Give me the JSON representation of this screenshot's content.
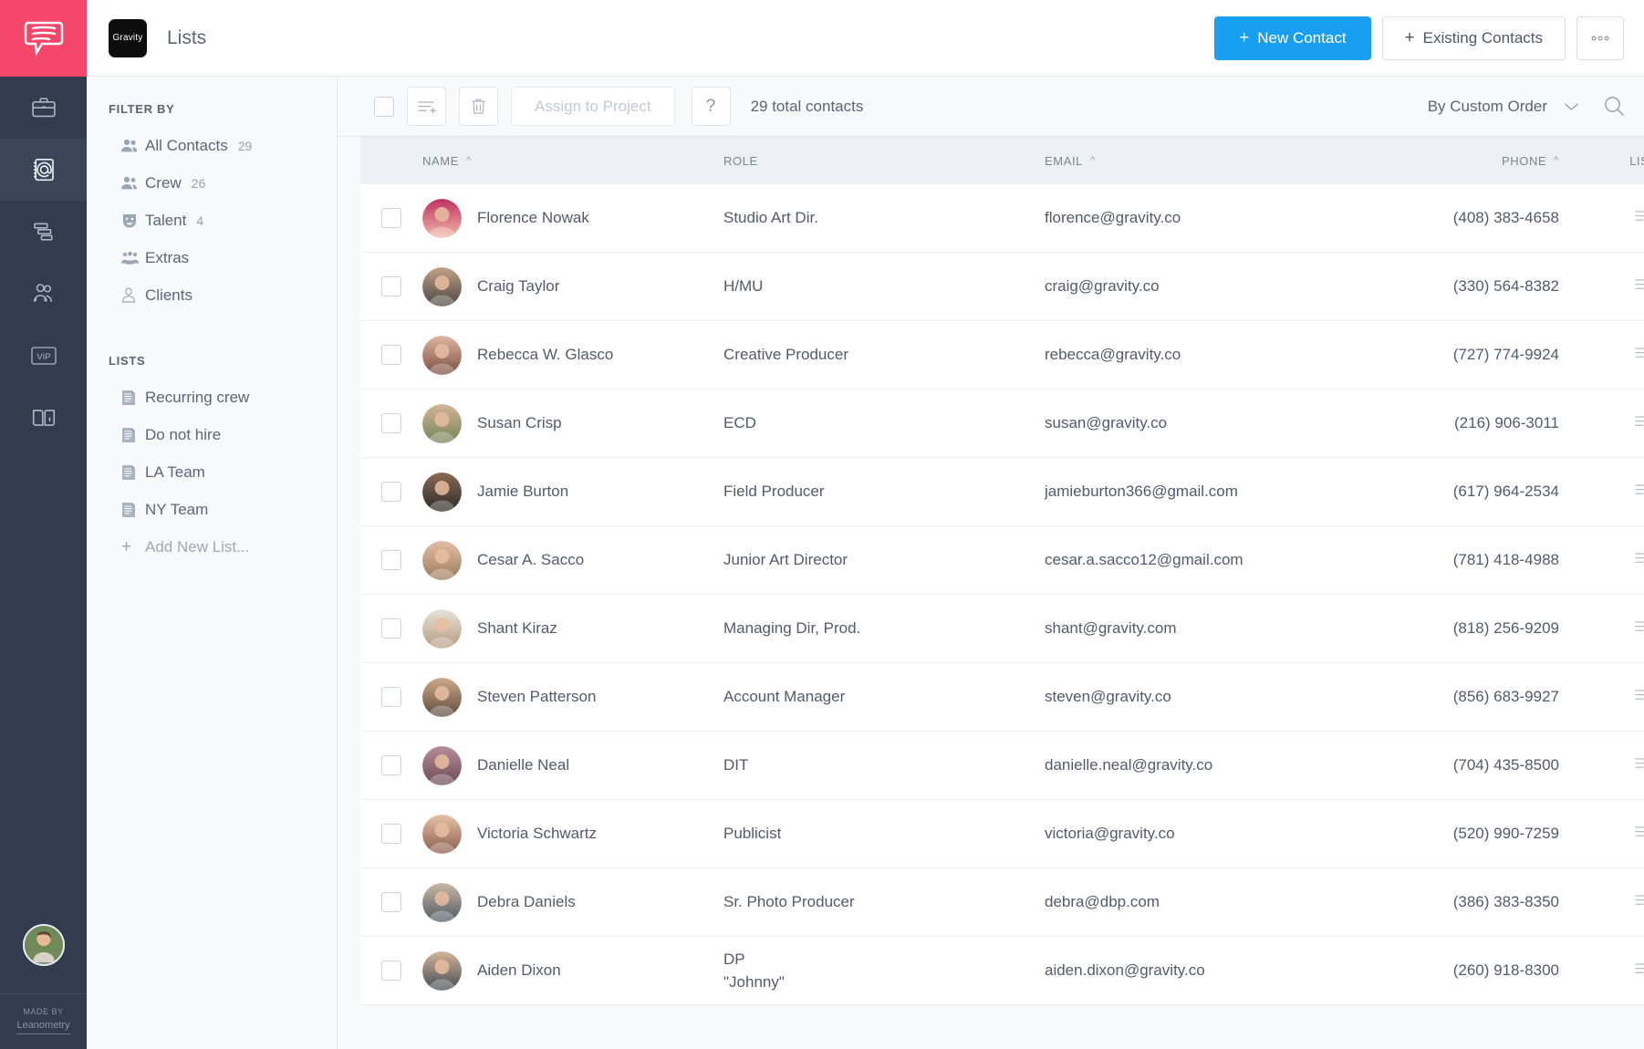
{
  "rail": {
    "logo_icon": "chat-bubble-lines-logo",
    "items": [
      {
        "name": "projects",
        "icon": "briefcase-icon",
        "active": false
      },
      {
        "name": "contacts",
        "icon": "address-book-at-icon",
        "active": true
      },
      {
        "name": "schedule",
        "icon": "gantt-bars-icon",
        "active": false
      },
      {
        "name": "crew",
        "icon": "people-group-icon",
        "active": false
      },
      {
        "name": "vip",
        "icon": "vip-badge-icon",
        "active": false
      },
      {
        "name": "guide",
        "icon": "open-book-info-icon",
        "active": false
      }
    ],
    "footer": {
      "made_by": "MADE BY",
      "brand": "Leanometry"
    }
  },
  "header": {
    "brand_tile": "Gravity",
    "title": "Lists",
    "new_contact": "New Contact",
    "existing_contacts": "Existing Contacts",
    "plus": "+",
    "more": "●●●",
    "accent_color": "#189ff2"
  },
  "sidebar": {
    "filter_heading": "FILTER BY",
    "filters": [
      {
        "label": "All Contacts",
        "count": "29",
        "icon": "two-people-icon"
      },
      {
        "label": "Crew",
        "count": "26",
        "icon": "person-pair-icon"
      },
      {
        "label": "Talent",
        "count": "4",
        "icon": "theater-mask-icon"
      },
      {
        "label": "Extras",
        "count": "",
        "icon": "crowd-icon"
      },
      {
        "label": "Clients",
        "count": "",
        "icon": "person-tie-icon"
      }
    ],
    "lists_heading": "LISTS",
    "lists": [
      {
        "label": "Recurring crew",
        "icon": "list-document-icon"
      },
      {
        "label": "Do not hire",
        "icon": "list-document-icon"
      },
      {
        "label": "LA Team",
        "icon": "list-document-icon"
      },
      {
        "label": "NY Team",
        "icon": "list-document-icon"
      }
    ],
    "add_new_list": "Add New List...",
    "add_plus": "+"
  },
  "toolbar": {
    "select_all": "",
    "add_to_list_icon": "lines-plus-icon",
    "delete_icon": "trash-icon",
    "assign_to_project": "Assign to Project",
    "help": "?",
    "total_contacts": "29 total contacts",
    "sort_label": "By Custom Order",
    "sort_chevron": "∨",
    "search_icon": "search-icon"
  },
  "table": {
    "columns": [
      {
        "key": "name",
        "label": "NAME",
        "sort": "^"
      },
      {
        "key": "role",
        "label": "ROLE",
        "sort": ""
      },
      {
        "key": "email",
        "label": "EMAIL",
        "sort": "^"
      },
      {
        "key": "phone",
        "label": "PHONE",
        "sort": "^"
      },
      {
        "key": "list",
        "label": "LIST",
        "sort": ""
      }
    ],
    "rows": [
      {
        "name": "Florence Nowak",
        "role": "Studio Art Dir.",
        "role2": "",
        "email": "florence@gravity.co",
        "phone": "(408) 383-4658",
        "avatar_from": "#c03060",
        "avatar_to": "#f1b9a8"
      },
      {
        "name": "Craig Taylor",
        "role": "H/MU",
        "role2": "",
        "email": "craig@gravity.co",
        "phone": "(330) 564-8382",
        "avatar_from": "#c2a189",
        "avatar_to": "#4a4540"
      },
      {
        "name": "Rebecca W. Glasco",
        "role": "Creative Producer",
        "role2": "",
        "email": "rebecca@gravity.co",
        "phone": "(727) 774-9924",
        "avatar_from": "#e0b6a4",
        "avatar_to": "#7a4b3c"
      },
      {
        "name": "Susan Crisp",
        "role": "ECD",
        "role2": "",
        "email": "susan@gravity.co",
        "phone": "(216) 906-3011",
        "avatar_from": "#d8b49a",
        "avatar_to": "#6e8456"
      },
      {
        "name": "Jamie Burton",
        "role": "Field Producer",
        "role2": "",
        "email": "jamieburton366@gmail.com",
        "phone": "(617) 964-2534",
        "avatar_from": "#8a6a55",
        "avatar_to": "#2d2a27"
      },
      {
        "name": "Cesar A. Sacco",
        "role": "Junior Art Director",
        "role2": "",
        "email": "cesar.a.sacco12@gmail.com",
        "phone": "(781) 418-4988",
        "avatar_from": "#e3bda3",
        "avatar_to": "#9d7b5e"
      },
      {
        "name": "Shant Kiraz",
        "role": "Managing Dir, Prod.",
        "role2": "",
        "email": "shant@gravity.com",
        "phone": "(818) 256-9209",
        "avatar_from": "#e8e2da",
        "avatar_to": "#b69a80"
      },
      {
        "name": "Steven Patterson",
        "role": "Account Manager",
        "role2": "",
        "email": "steven@gravity.co",
        "phone": "(856) 683-9927",
        "avatar_from": "#cfa98a",
        "avatar_to": "#5b4b3d"
      },
      {
        "name": "Danielle Neal",
        "role": "DIT",
        "role2": "",
        "email": "danielle.neal@gravity.co",
        "phone": "(704) 435-8500",
        "avatar_from": "#b98d9a",
        "avatar_to": "#6b4a55"
      },
      {
        "name": "Victoria Schwartz",
        "role": "Publicist",
        "role2": "",
        "email": "victoria@gravity.co",
        "phone": "(520) 990-7259",
        "avatar_from": "#e6c2ab",
        "avatar_to": "#8a5c46"
      },
      {
        "name": "Debra Daniels",
        "role": "Sr. Photo Producer",
        "role2": "",
        "email": "debra@dbp.com",
        "phone": "(386) 383-8350",
        "avatar_from": "#cbb7a5",
        "avatar_to": "#4d5a63"
      },
      {
        "name": "Aiden Dixon",
        "role": "DP",
        "role2": "\"Johnny\"",
        "email": "aiden.dixon@gravity.co",
        "phone": "(260) 918-8300",
        "avatar_from": "#d7b49a",
        "avatar_to": "#3f4a52"
      }
    ],
    "row_list_icon": "add-to-list-icon",
    "row_menu_icon": "vertical-dots-icon"
  }
}
